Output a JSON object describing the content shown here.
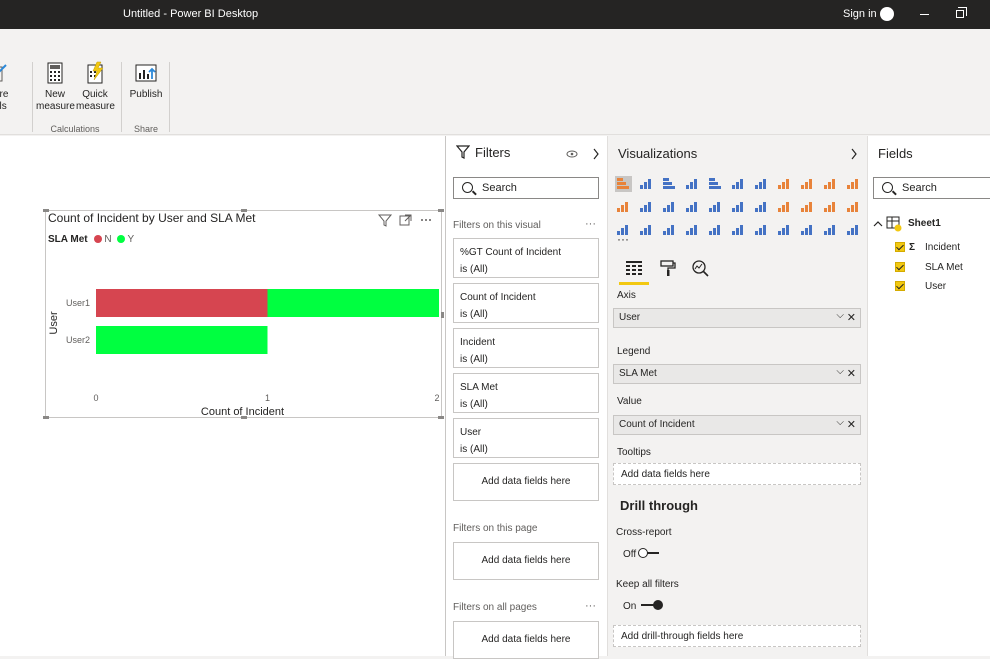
{
  "window": {
    "title": "Untitled - Power BI Desktop",
    "signin": "Sign in"
  },
  "ribbon": {
    "partial_btn_line1": "ore",
    "partial_btn_line2": "als",
    "new_measure_l1": "New",
    "new_measure_l2": "measure",
    "quick_measure_l1": "Quick",
    "quick_measure_l2": "measure",
    "publish": "Publish",
    "group_calculations": "Calculations",
    "group_share": "Share"
  },
  "visual": {
    "title": "Count of Incident by User and SLA Met",
    "legend_title": "SLA Met",
    "legend_items": [
      {
        "name": "N",
        "color": "#d64550"
      },
      {
        "name": "Y",
        "color": "#00ff40"
      }
    ]
  },
  "chart_data": {
    "type": "bar",
    "orientation": "horizontal",
    "stacked": true,
    "title": "Count of Incident by User and SLA Met",
    "xlabel": "Count of Incident",
    "ylabel": "User",
    "categories": [
      "User1",
      "User2"
    ],
    "series": [
      {
        "name": "N",
        "color": "#d64550",
        "values": [
          1,
          0
        ]
      },
      {
        "name": "Y",
        "color": "#00ff40",
        "values": [
          1,
          1
        ]
      }
    ],
    "xlim": [
      0,
      2
    ],
    "xticks": [
      "0",
      "1",
      "2"
    ],
    "legend_placement": "top-left"
  },
  "filters": {
    "title": "Filters",
    "search_placeholder": "Search",
    "on_visual": "Filters on this visual",
    "on_page": "Filters on this page",
    "on_all": "Filters on all pages",
    "dots": "···",
    "cards": [
      {
        "field": "%GT Count of Incident",
        "state": "is (All)"
      },
      {
        "field": "Count of Incident",
        "state": "is (All)"
      },
      {
        "field": "Incident",
        "state": "is (All)"
      },
      {
        "field": "SLA Met",
        "state": "is (All)"
      },
      {
        "field": "User",
        "state": "is (All)"
      }
    ],
    "add_fields": "Add data fields here"
  },
  "viz": {
    "title": "Visualizations",
    "more": "···",
    "axis_label": "Axis",
    "axis_value": "User",
    "legend_label": "Legend",
    "legend_value": "SLA Met",
    "value_label": "Value",
    "value_value": "Count of Incident",
    "tooltips_label": "Tooltips",
    "tooltips_add": "Add data fields here",
    "drill_title": "Drill through",
    "cross_report": "Cross-report",
    "cross_state": "Off",
    "keep_filters": "Keep all filters",
    "keep_state": "On",
    "drill_add": "Add drill-through fields here"
  },
  "fields": {
    "title": "Fields",
    "search_placeholder": "Search",
    "table": "Sheet1",
    "items": [
      {
        "name": "Incident",
        "sigma": "Σ"
      },
      {
        "name": "SLA Met"
      },
      {
        "name": "User"
      }
    ]
  }
}
